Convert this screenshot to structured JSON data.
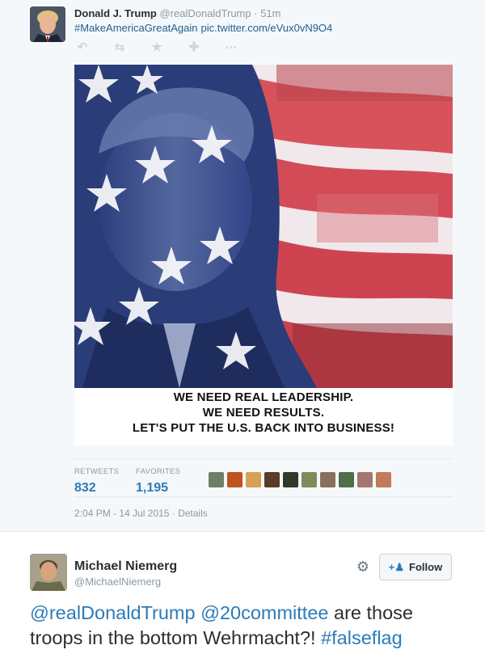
{
  "tweet": {
    "name": "Donald J. Trump",
    "handle": "@realDonaldTrump",
    "time": "· 51m",
    "hashtag": "#MakeAmericaGreatAgain",
    "link": "pic.twitter.com/eVux0vN9O4",
    "icons": [
      "reply-icon",
      "retweet-icon",
      "favorite-icon",
      "follow-icon",
      "more-icon"
    ],
    "image_text": [
      "WE NEED REAL LEADERSHIP.",
      "WE NEED RESULTS.",
      "LET'S PUT THE U.S. BACK INTO BUSINESS!"
    ],
    "stats": {
      "retweets_label": "RETWEETS",
      "retweets": "832",
      "favorites_label": "FAVORITES",
      "favorites": "1,195"
    },
    "timestamp": "2:04 PM - 14 Jul 2015",
    "details": "Details"
  },
  "reply": {
    "name": "Michael Niemerg",
    "handle": "@MichaelNiemerg",
    "follow_label": "Follow",
    "mentions": [
      "@realDonaldTrump",
      "@20committee"
    ],
    "text1": "are those",
    "text2": "troops in the bottom Wehrmacht?!",
    "hashtag": "#falseflag"
  },
  "colors": {
    "link": "#2b7bb9",
    "flag_red": "#c8323d",
    "flag_blue": "#2a3d78",
    "meta_gray": "#8899a6"
  }
}
